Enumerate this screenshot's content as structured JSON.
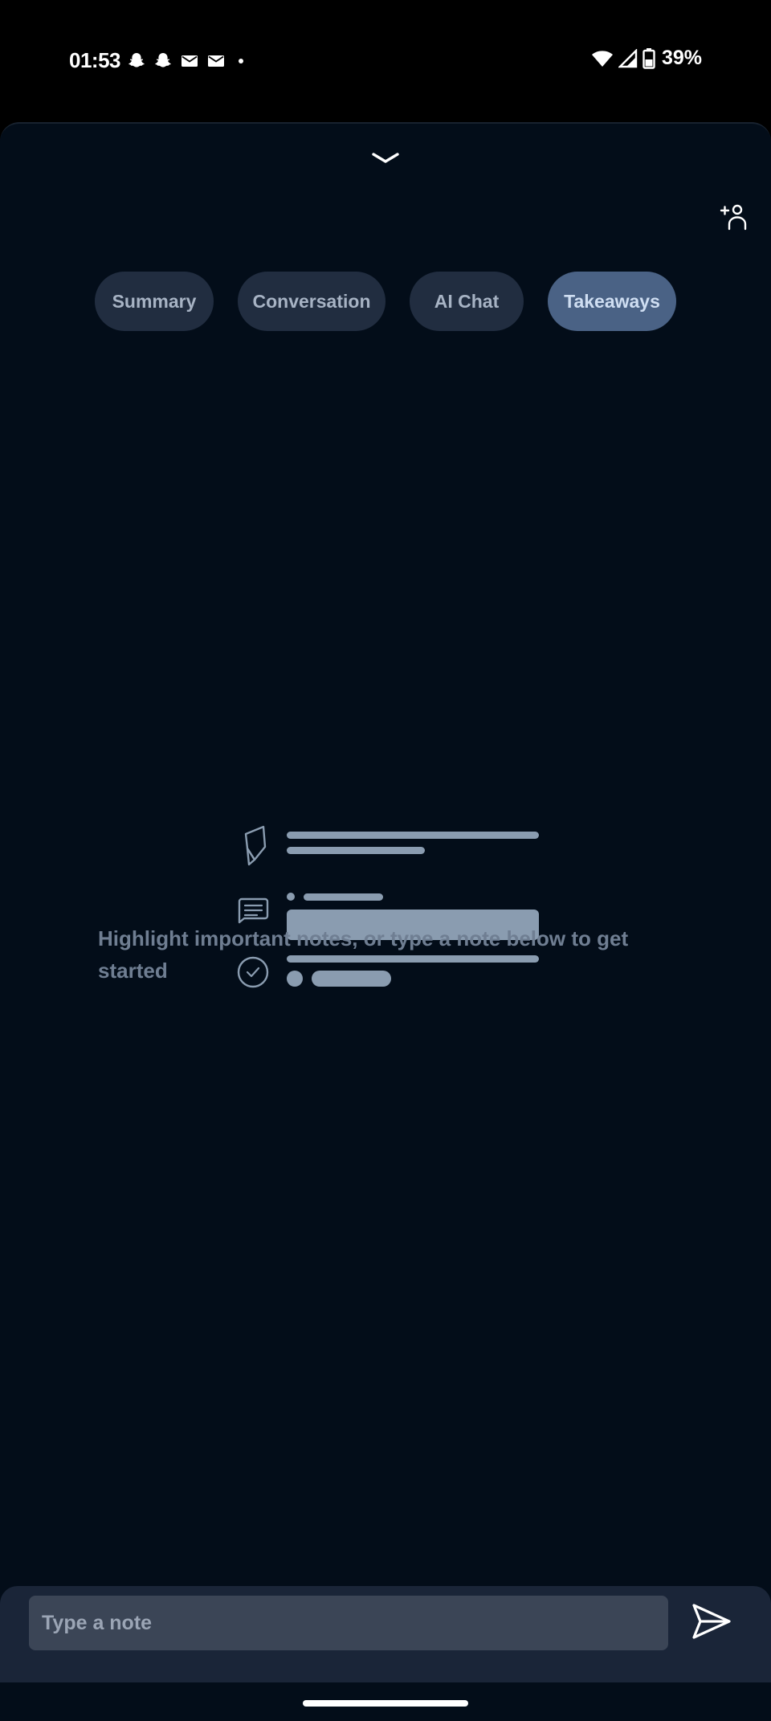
{
  "status_bar": {
    "time": "01:53",
    "battery": "39%",
    "notification_icons": [
      "snapchat-icon",
      "snapchat-icon",
      "gmail-icon",
      "gmail-icon",
      "dot-icon"
    ],
    "status_icons": [
      "wifi-icon",
      "cell-signal-icon",
      "battery-icon"
    ]
  },
  "header": {
    "collapse_icon": "chevron-down-icon",
    "add_person_icon": "add-person-icon"
  },
  "tabs": [
    {
      "label": "Summary",
      "active": false
    },
    {
      "label": "Conversation",
      "active": false
    },
    {
      "label": "AI Chat",
      "active": false
    },
    {
      "label": "Takeaways",
      "active": true
    }
  ],
  "empty_state": {
    "icons": [
      "highlighter-icon",
      "message-icon",
      "check-circle-icon"
    ],
    "message": "Highlight important notes, or type a note below to get started"
  },
  "composer": {
    "placeholder": "Type a note",
    "value": "",
    "send_icon": "send-icon"
  },
  "colors": {
    "background": "#030d19",
    "tab_inactive": "#212d40",
    "tab_active": "#4a6285",
    "skeleton": "#8a9cb0",
    "input_bar": "#1a2538"
  }
}
